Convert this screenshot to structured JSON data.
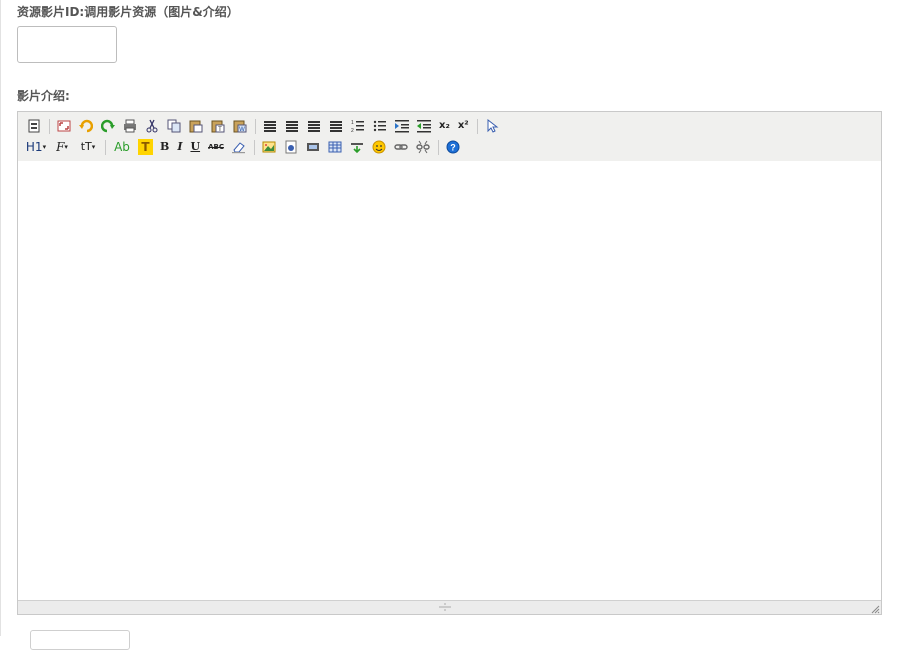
{
  "form": {
    "resource_id_label": "资源影片ID:调用影片资源（图片&介绍）",
    "resource_id_value": "",
    "intro_label": "影片介绍:"
  },
  "editor": {
    "toolbar_text": {
      "heading": "H1",
      "font_family": "F",
      "font_size": "tT",
      "font_color": "Ab",
      "highlight": "T",
      "bold": "B",
      "italic": "I",
      "underline": "U",
      "strikethrough": "ABC",
      "subscript": "x₂",
      "superscript": "x²"
    },
    "content": ""
  },
  "colors": {
    "accent_orange": "#e8a000",
    "highlight_yellow": "#ffd400",
    "help_blue": "#1d6fd6",
    "font_color_green": "#2a9d2a"
  }
}
